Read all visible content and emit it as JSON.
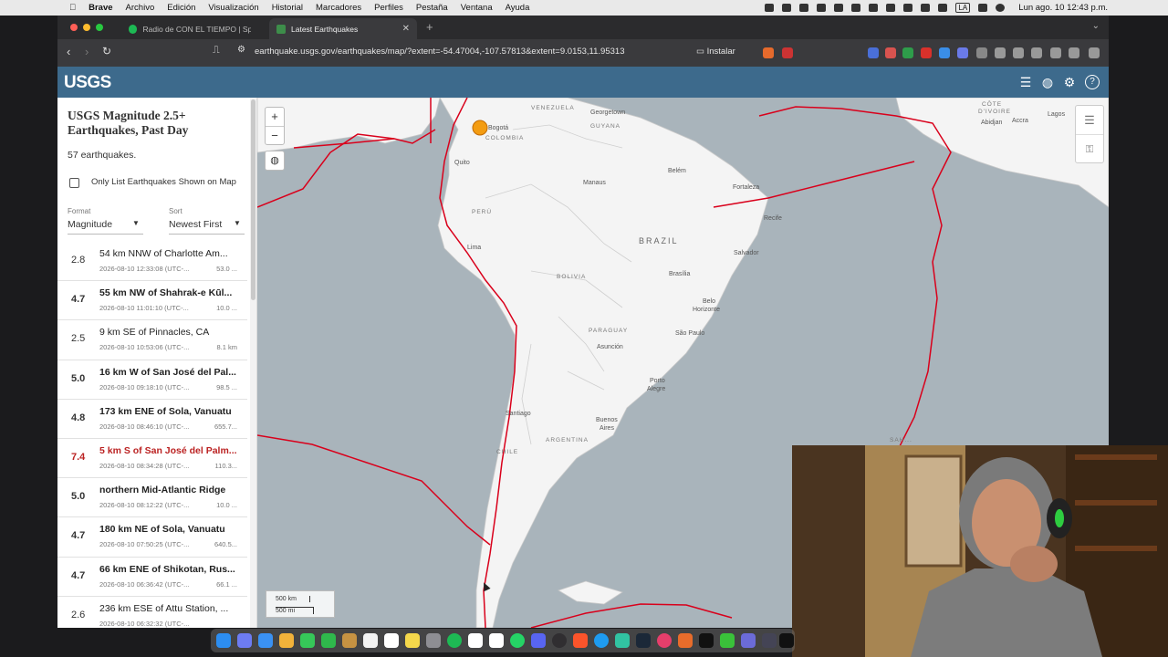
{
  "menubar": {
    "app": "Brave",
    "items": [
      "Archivo",
      "Edición",
      "Visualización",
      "Historial",
      "Marcadores",
      "Perfiles",
      "Pestaña",
      "Ventana",
      "Ayuda"
    ],
    "input_source": "LA",
    "clock": "Lun ago. 10  12:43 p.m."
  },
  "browser": {
    "tabs": [
      {
        "label": "Radio de CON EL TIEMPO | Spotify"
      },
      {
        "label": "Latest Earthquakes"
      }
    ],
    "url": "earthquake.usgs.gov/earthquakes/map/?extent=-54.47004,-107.57813&extent=9.0153,11.95313",
    "install_label": "Instalar"
  },
  "usgs": {
    "logo": "USGS",
    "title": "USGS Magnitude 2.5+ Earthquakes, Past Day",
    "count_text": "57 earthquakes.",
    "only_list_label": "Only List Earthquakes Shown on Map",
    "format_label": "Format",
    "format_value": "Magnitude",
    "sort_label": "Sort",
    "sort_value": "Newest First",
    "earthquakes": [
      {
        "mag": "2.8",
        "place": "54 km NNW of Charlotte Am...",
        "time": "2026-08-10 12:33:08 (UTC-...",
        "depth": "53.0 ..."
      },
      {
        "mag": "4.7",
        "place": "55 km NW of Shahrak-e Kūl...",
        "time": "2026-08-10 11:01:10 (UTC-...",
        "depth": "10.0 ..."
      },
      {
        "mag": "2.5",
        "place": "9 km SE of Pinnacles, CA",
        "time": "2026-08-10 10:53:06 (UTC-...",
        "depth": "8.1 km"
      },
      {
        "mag": "5.0",
        "place": "16 km W of San José del Pal...",
        "time": "2026-08-10 09:18:10 (UTC-...",
        "depth": "98.5 ..."
      },
      {
        "mag": "4.8",
        "place": "173 km ENE of Sola, Vanuatu",
        "time": "2026-08-10 08:46:10 (UTC-...",
        "depth": "655.7..."
      },
      {
        "mag": "7.4",
        "place": "5 km S of San José del Palm...",
        "time": "2026-08-10 08:34:28 (UTC-...",
        "depth": "110.3..."
      },
      {
        "mag": "5.0",
        "place": "northern Mid-Atlantic Ridge",
        "time": "2026-08-10 08:12:22 (UTC-...",
        "depth": "10.0 ..."
      },
      {
        "mag": "4.7",
        "place": "180 km NE of Sola, Vanuatu",
        "time": "2026-08-10 07:50:25 (UTC-...",
        "depth": "640.5..."
      },
      {
        "mag": "4.7",
        "place": "66 km ENE of Shikotan, Rus...",
        "time": "2026-08-10 06:36:42 (UTC-...",
        "depth": "66.1 ..."
      },
      {
        "mag": "2.6",
        "place": "236 km ESE of Attu Station, ...",
        "time": "2026-08-10 06:32:32 (UTC-...",
        "depth": ""
      }
    ],
    "highlighted_index": 5
  },
  "map": {
    "zoom_in": "+",
    "zoom_out": "−",
    "labels": {
      "venezuela": "VENEZUELA",
      "georgetown": "Georgetown",
      "guyana": "GUYANA",
      "bogota": "Bogotá",
      "colombia": "COLOMBIA",
      "quito": "Quito",
      "manaus": "Manaus",
      "belem": "Belém",
      "fortaleza": "Fortaleza",
      "recife": "Recife",
      "peru": "PERÚ",
      "lima": "Lima",
      "brazil": "BRAZIL",
      "salvador": "Salvador",
      "bolivia": "BOLIVIA",
      "brasilia": "Brasília",
      "belo": "Belo",
      "horizonte": "Horizonte",
      "paraguay": "PARAGUAY",
      "asuncion": "Asunción",
      "saopaulo": "São Paulo",
      "porto": "Porto",
      "alegre": "Alegre",
      "santiago": "Santiago",
      "buenos": "Buenos",
      "aires": "Aires",
      "argentina": "ARGENTINA",
      "chile": "CHILE",
      "cote": "CÔTE",
      "divoire": "D'IVOIRE",
      "abidjan": "Abidjan",
      "accra": "Accra",
      "lagos": "Lagos",
      "sahel": "SAH..."
    },
    "scale_km": "500 km",
    "scale_mi": "500 mi",
    "colors": {
      "plate_boundary": "#d9001b",
      "quake": "#f39c12",
      "land": "#f4f4f4",
      "ocean": "#a9b4bb"
    }
  }
}
